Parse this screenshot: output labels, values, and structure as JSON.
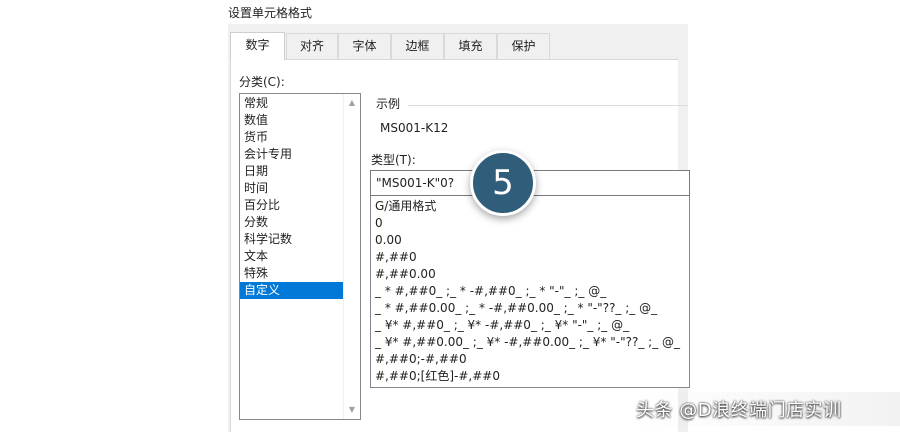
{
  "dialog": {
    "title": "设置单元格格式"
  },
  "tabs": [
    {
      "label": "数字",
      "active": true
    },
    {
      "label": "对齐",
      "active": false
    },
    {
      "label": "字体",
      "active": false
    },
    {
      "label": "边框",
      "active": false
    },
    {
      "label": "填充",
      "active": false
    },
    {
      "label": "保护",
      "active": false
    }
  ],
  "category": {
    "label": "分类(C):",
    "items": [
      "常规",
      "数值",
      "货币",
      "会计专用",
      "日期",
      "时间",
      "百分比",
      "分数",
      "科学记数",
      "文本",
      "特殊",
      "自定义"
    ],
    "selected": "自定义"
  },
  "sample": {
    "label": "示例",
    "value": "MS001-K12"
  },
  "type": {
    "label": "类型(T):",
    "value": "\"MS001-K\"0?"
  },
  "formats": [
    "G/通用格式",
    "0",
    "0.00",
    "#,##0",
    "#,##0.00",
    "_ * #,##0_ ;_ * -#,##0_ ;_ * \"-\"_ ;_ @_",
    "_ * #,##0.00_ ;_ * -#,##0.00_ ;_ * \"-\"??_ ;_ @_",
    "_ ¥* #,##0_ ;_ ¥* -#,##0_ ;_ ¥* \"-\"_ ;_ @_",
    "_ ¥* #,##0.00_ ;_ ¥* -#,##0.00_ ;_ ¥* \"-\"??_ ;_ @_",
    "#,##0;-#,##0",
    "#,##0;[红色]-#,##0"
  ],
  "annotation": {
    "step_number": "5"
  },
  "watermark": {
    "text": "头条 @D浪终端门店实训"
  },
  "colors": {
    "selection": "#0078d7",
    "badge": "#2f5d7a"
  }
}
